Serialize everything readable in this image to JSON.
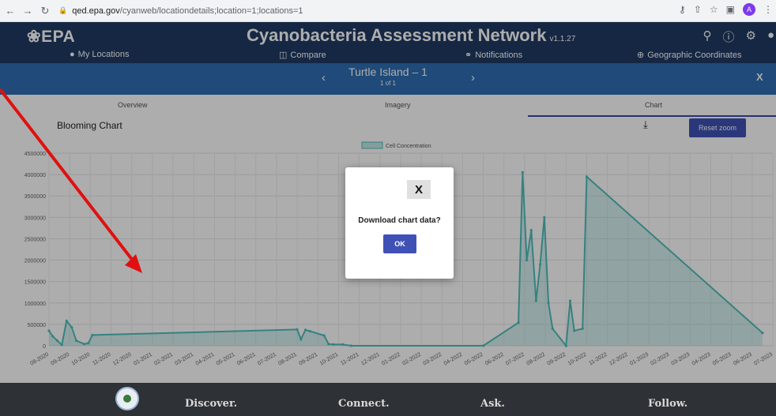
{
  "browser": {
    "url_host": "qed.epa.gov",
    "url_path": "/cyanweb/locationdetails;location=1;locations=1",
    "avatar_letter": "A"
  },
  "header": {
    "logo": "❀EPA",
    "title": "Cyanobacteria Assessment Network",
    "version": "v1.1.27",
    "menu": [
      {
        "label": "My Locations",
        "icon": "map-marker-icon"
      },
      {
        "label": "Compare",
        "icon": "compare-icon"
      },
      {
        "label": "Notifications",
        "icon": "notifications-icon"
      },
      {
        "label": "Geographic Coordinates",
        "icon": "plus-circle-icon"
      }
    ]
  },
  "location": {
    "name": "Turtle Island – 1",
    "page": "1 of 1",
    "close": "X"
  },
  "tabs": [
    "Overview",
    "Imagery",
    "Chart"
  ],
  "active_tab": "Chart",
  "chart_panel": {
    "title": "Blooming Chart",
    "reset_zoom": "Reset zoom"
  },
  "chart_data": {
    "type": "area",
    "title": "",
    "series": [
      {
        "name": "Cell Concentration",
        "color": "#4fc0bb"
      }
    ],
    "y_ticks": [
      0,
      500000,
      1000000,
      1500000,
      2000000,
      2500000,
      3000000,
      3500000,
      4000000,
      4500000
    ],
    "ylim": [
      0,
      4500000
    ],
    "x_ticks": [
      "08-2020",
      "09-2020",
      "10-2020",
      "11-2020",
      "12-2020",
      "01-2021",
      "02-2021",
      "03-2021",
      "04-2021",
      "05-2021",
      "06-2021",
      "07-2021",
      "08-2021",
      "09-2021",
      "10-2021",
      "11-2021",
      "12-2021",
      "01-2022",
      "02-2022",
      "03-2022",
      "04-2022",
      "05-2022",
      "06-2022",
      "07-2022",
      "08-2022",
      "09-2022",
      "10-2022",
      "11-2022",
      "12-2022",
      "01-2023",
      "02-2023",
      "03-2023",
      "04-2023",
      "05-2023",
      "06-2023",
      "07-2023"
    ],
    "points": [
      {
        "x": 0.0,
        "y": 350000
      },
      {
        "x": 0.18,
        "y": 220000
      },
      {
        "x": 0.4,
        "y": 120000
      },
      {
        "x": 0.62,
        "y": 20000
      },
      {
        "x": 0.85,
        "y": 580000
      },
      {
        "x": 1.1,
        "y": 430000
      },
      {
        "x": 1.32,
        "y": 120000
      },
      {
        "x": 1.7,
        "y": 40000
      },
      {
        "x": 1.9,
        "y": 60000
      },
      {
        "x": 2.1,
        "y": 250000
      },
      {
        "x": 12.0,
        "y": 380000
      },
      {
        "x": 12.18,
        "y": 150000
      },
      {
        "x": 12.4,
        "y": 370000
      },
      {
        "x": 12.62,
        "y": 340000
      },
      {
        "x": 13.3,
        "y": 240000
      },
      {
        "x": 13.52,
        "y": 40000
      },
      {
        "x": 13.75,
        "y": 30000
      },
      {
        "x": 14.2,
        "y": 30000
      },
      {
        "x": 14.6,
        "y": 0
      },
      {
        "x": 21.0,
        "y": 0
      },
      {
        "x": 22.7,
        "y": 540000
      },
      {
        "x": 22.9,
        "y": 4050000
      },
      {
        "x": 23.1,
        "y": 2000000
      },
      {
        "x": 23.32,
        "y": 2700000
      },
      {
        "x": 23.55,
        "y": 1050000
      },
      {
        "x": 23.75,
        "y": 1900000
      },
      {
        "x": 23.95,
        "y": 3000000
      },
      {
        "x": 24.15,
        "y": 1000000
      },
      {
        "x": 24.35,
        "y": 400000
      },
      {
        "x": 25.0,
        "y": 0
      },
      {
        "x": 25.2,
        "y": 1050000
      },
      {
        "x": 25.4,
        "y": 350000
      },
      {
        "x": 25.8,
        "y": 400000
      },
      {
        "x": 26.0,
        "y": 3950000
      },
      {
        "x": 34.5,
        "y": 300000
      }
    ]
  },
  "dialog": {
    "close": "X",
    "message": "Download chart data?",
    "ok": "OK"
  },
  "footer": {
    "links": [
      "Discover.",
      "Connect.",
      "Ask.",
      "Follow."
    ]
  }
}
